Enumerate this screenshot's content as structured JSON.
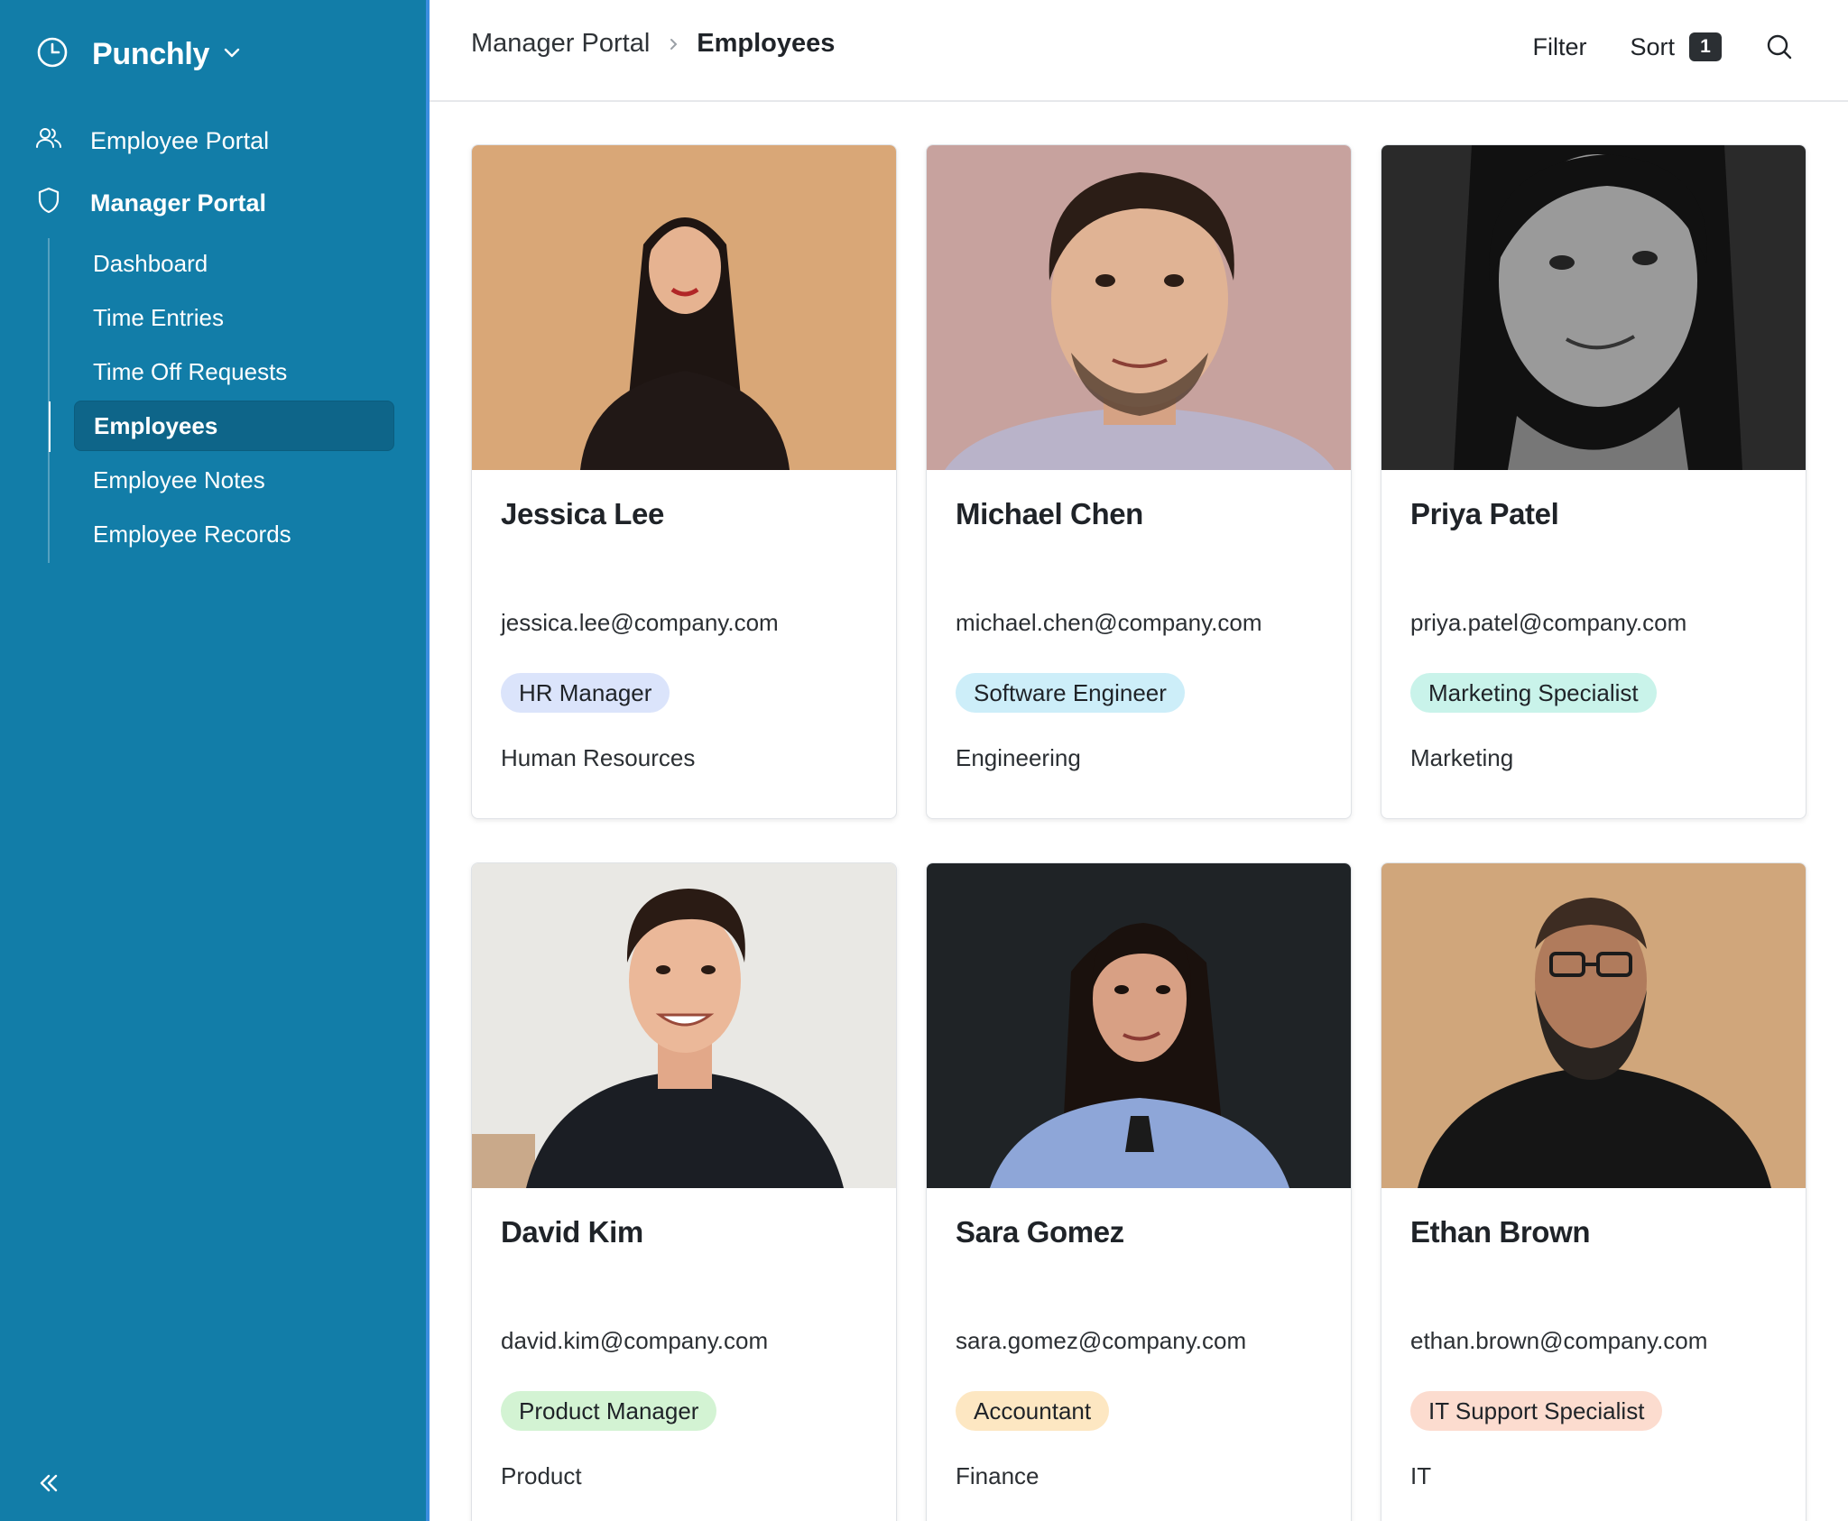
{
  "app": {
    "name": "Punchly"
  },
  "sidebar": {
    "portals": [
      {
        "label": "Employee Portal",
        "icon": "users-icon"
      },
      {
        "label": "Manager Portal",
        "icon": "shield-icon"
      }
    ],
    "subnav": [
      "Dashboard",
      "Time Entries",
      "Time Off Requests",
      "Employees",
      "Employee Notes",
      "Employee Records"
    ],
    "active": "Employees",
    "collapse_icon": "chevrons-left-icon"
  },
  "header": {
    "breadcrumb_parent": "Manager Portal",
    "breadcrumb_current": "Employees",
    "filter_label": "Filter",
    "sort_label": "Sort",
    "sort_count": "1"
  },
  "colors": {
    "sidebar_bg": "#127da8",
    "active_item_bg": "#0e6589",
    "tag_hr": "#dbe4fb",
    "tag_software": "#cdeef9",
    "tag_marketing": "#c9f3ea",
    "tag_product": "#d3f3d3",
    "tag_accountant": "#fde7c2",
    "tag_it": "#fcdccf"
  },
  "employees": [
    {
      "name": "Jessica Lee",
      "email": "jessica.lee@company.com",
      "role": "HR Manager",
      "department": "Human Resources"
    },
    {
      "name": "Michael Chen",
      "email": "michael.chen@company.com",
      "role": "Software Engineer",
      "department": "Engineering"
    },
    {
      "name": "Priya Patel",
      "email": "priya.patel@company.com",
      "role": "Marketing Specialist",
      "department": "Marketing"
    },
    {
      "name": "David Kim",
      "email": "david.kim@company.com",
      "role": "Product Manager",
      "department": "Product"
    },
    {
      "name": "Sara Gomez",
      "email": "sara.gomez@company.com",
      "role": "Accountant",
      "department": "Finance"
    },
    {
      "name": "Ethan Brown",
      "email": "ethan.brown@company.com",
      "role": "IT Support Specialist",
      "department": "IT"
    }
  ]
}
